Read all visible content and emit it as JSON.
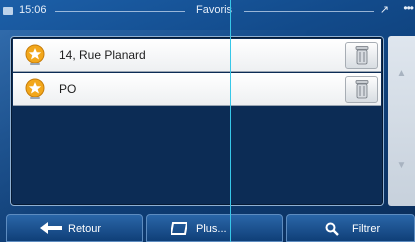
{
  "status_bar": {
    "time": "15:06",
    "title": "Favoris",
    "gps_label": "↗",
    "menu_dots": "•••"
  },
  "favorites": [
    {
      "label": "14, Rue Planard",
      "icon": "star-pin-icon",
      "action_icon": "trash-icon"
    },
    {
      "label": "PO",
      "icon": "star-pin-icon",
      "action_icon": "trash-icon"
    }
  ],
  "scroll": {
    "up": "▲",
    "down": "▼"
  },
  "bottom_bar": {
    "back_label": "Retour",
    "more_label": "Plus...",
    "filter_label": "Filtrer"
  },
  "colors": {
    "background": "#124a8a",
    "list_bg": "#0c2c55",
    "star": "#f2a71b",
    "overlay_line": "#37c7e8"
  }
}
